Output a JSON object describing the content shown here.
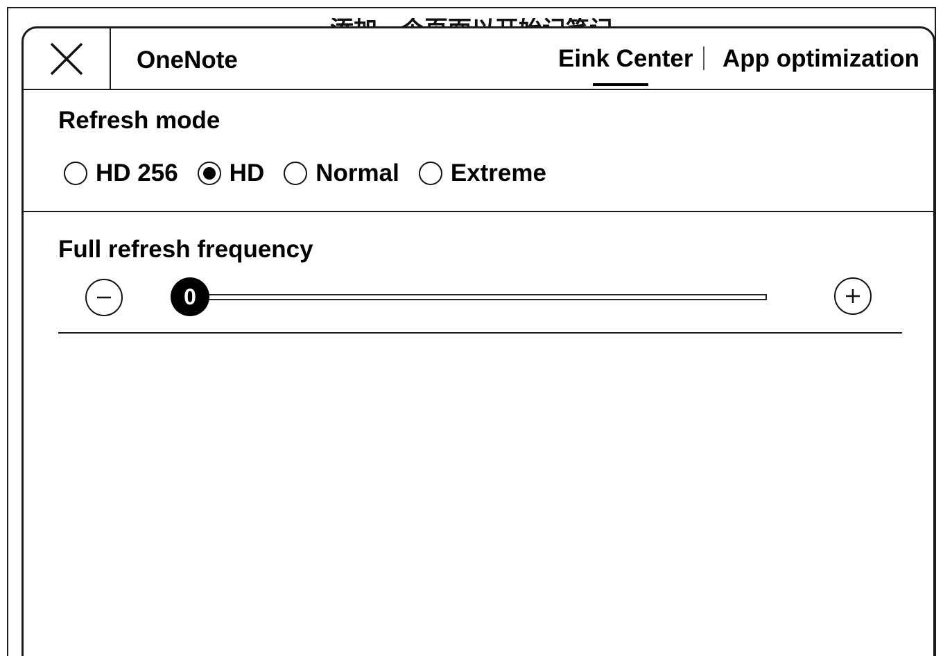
{
  "background": {
    "title": "添加一个页面以开始记笔记"
  },
  "dialog": {
    "app_name": "OneNote",
    "tabs": [
      {
        "label": "Eink Center",
        "active": true
      },
      {
        "label": "App optimization",
        "active": false
      }
    ],
    "refresh_mode": {
      "title": "Refresh mode",
      "options": [
        {
          "label": "HD 256",
          "selected": false
        },
        {
          "label": "HD",
          "selected": true
        },
        {
          "label": "Normal",
          "selected": false
        },
        {
          "label": "Extreme",
          "selected": false
        }
      ]
    },
    "full_refresh": {
      "title": "Full refresh frequency",
      "value": "0",
      "slider_fraction": 0
    }
  },
  "icons": {
    "close": "close-icon",
    "minus": "minus-icon",
    "plus": "plus-icon"
  }
}
